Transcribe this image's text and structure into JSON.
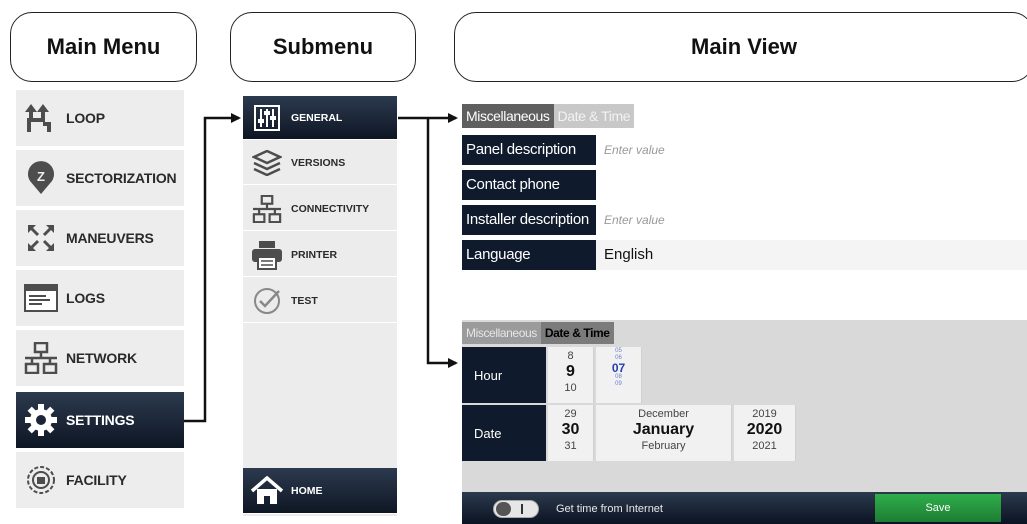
{
  "headers": {
    "main_menu": "Main Menu",
    "submenu": "Submenu",
    "main_view": "Main View"
  },
  "main_menu": {
    "items": [
      {
        "label": "LOOP",
        "icon": "loop-icon"
      },
      {
        "label": "SECTORIZATION",
        "icon": "sectorization-icon"
      },
      {
        "label": "MANEUVERS",
        "icon": "maneuvers-icon"
      },
      {
        "label": "LOGS",
        "icon": "logs-icon"
      },
      {
        "label": "NETWORK",
        "icon": "network-icon"
      },
      {
        "label": "SETTINGS",
        "icon": "gear-icon",
        "active": true
      },
      {
        "label": "FACILITY",
        "icon": "facility-icon"
      }
    ]
  },
  "submenu": {
    "items": [
      {
        "label": "GENERAL",
        "icon": "sliders-icon",
        "active": true
      },
      {
        "label": "VERSIONS",
        "icon": "layers-icon"
      },
      {
        "label": "CONNECTIVITY",
        "icon": "network-icon"
      },
      {
        "label": "PRINTER",
        "icon": "printer-icon"
      },
      {
        "label": "TEST",
        "icon": "check-icon"
      }
    ],
    "home": {
      "label": "HOME",
      "icon": "home-icon"
    }
  },
  "view1": {
    "tabs": [
      "Miscellaneous",
      "Date & Time"
    ],
    "rows": [
      {
        "key": "Panel description",
        "placeholder": "Enter value",
        "value": ""
      },
      {
        "key": "Contact phone",
        "placeholder": "",
        "value": ""
      },
      {
        "key": "Installer description",
        "placeholder": "Enter value",
        "value": ""
      },
      {
        "key": "Language",
        "placeholder": "",
        "value": "English"
      }
    ]
  },
  "view2": {
    "tabs": [
      "Miscellaneous",
      "Date & Time"
    ],
    "hour": {
      "label": "Hour",
      "prev": "8",
      "current": "9",
      "next": "10",
      "min_prev2": "05",
      "min_prev": "06",
      "min_current": "07",
      "min_next": "08",
      "min_next2": "09"
    },
    "date": {
      "label": "Date",
      "day": {
        "prev": "29",
        "current": "30",
        "next": "31"
      },
      "month": {
        "prev": "December",
        "current": "January",
        "next": "February"
      },
      "year": {
        "prev": "2019",
        "current": "2020",
        "next": "2021"
      }
    },
    "get_time_label": "Get time from Internet",
    "save_label": "Save"
  },
  "colors": {
    "dark_navy": "#0f1a2c",
    "save_green": "#2fae4a",
    "menu_bg": "#ededed"
  }
}
